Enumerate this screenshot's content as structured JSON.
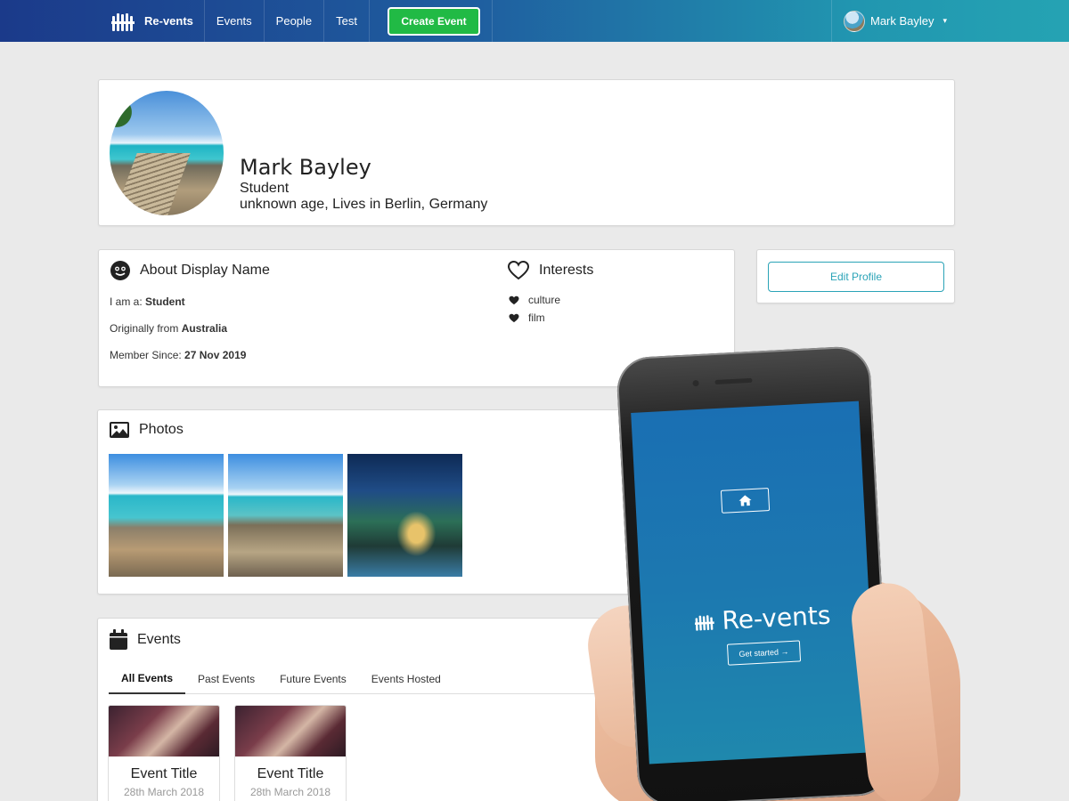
{
  "nav": {
    "brand": "Re-vents",
    "items": [
      "Events",
      "People",
      "Test"
    ],
    "create_label": "Create Event",
    "user_name": "Mark Bayley",
    "caret": "▾"
  },
  "profile": {
    "name": "Mark Bayley",
    "role": "Student",
    "meta": "unknown age, Lives in Berlin, Germany"
  },
  "about": {
    "title": "About Display Name",
    "rows": [
      {
        "label": "I am a: ",
        "value": "Student"
      },
      {
        "label": "Originally from ",
        "value": "Australia"
      },
      {
        "label": "Member Since: ",
        "value": "27 Nov 2019"
      }
    ]
  },
  "interests": {
    "title": "Interests",
    "items": [
      "culture",
      "film"
    ]
  },
  "edit_profile_label": "Edit Profile",
  "photos": {
    "title": "Photos"
  },
  "events": {
    "title": "Events",
    "tabs": [
      "All Events",
      "Past Events",
      "Future Events",
      "Events Hosted"
    ],
    "active_tab": "All Events",
    "cards": [
      {
        "title": "Event Title",
        "date": "28th March 2018"
      },
      {
        "title": "Event Title",
        "date": "28th March 2018"
      }
    ]
  },
  "phone_app": {
    "brand": "Re-vents",
    "start_label": "Get started",
    "start_arrow": "→"
  },
  "colors": {
    "nav_start": "#1b3a8a",
    "nav_end": "#25a3b3",
    "create_button": "#21ba45",
    "edit_outline": "#2aa3b7",
    "page_bg": "#eaeaea"
  },
  "icons": [
    "logo-icon",
    "smile-icon",
    "heart-outline-icon",
    "heart-icon",
    "image-icon",
    "calendar-icon",
    "home-icon"
  ]
}
